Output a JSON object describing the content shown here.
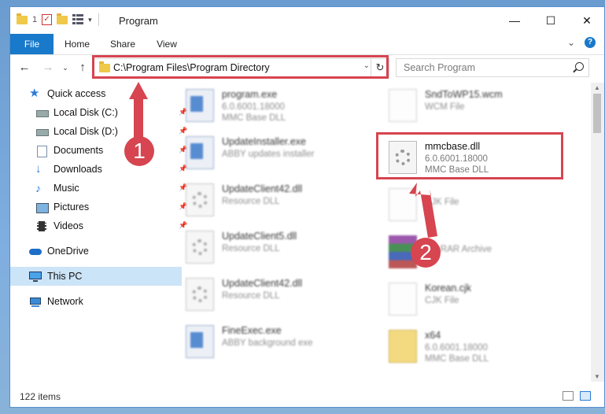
{
  "window": {
    "title": "Program"
  },
  "qat": {
    "number": "1"
  },
  "ribbon": {
    "tabs": [
      "File",
      "Home",
      "Share",
      "View"
    ]
  },
  "address": {
    "path": "C:\\Program Files\\Program Directory"
  },
  "search": {
    "placeholder": "Search Program"
  },
  "sidebar": {
    "items": [
      {
        "label": "Quick access",
        "icon": "star-icon"
      },
      {
        "label": "Local Disk (C:)",
        "icon": "drive-icon",
        "pinned": true
      },
      {
        "label": "Local Disk (D:)",
        "icon": "drive-icon",
        "pinned": true
      },
      {
        "label": "Documents",
        "icon": "documents-icon",
        "pinned": true
      },
      {
        "label": "Downloads",
        "icon": "downloads-icon",
        "pinned": true
      },
      {
        "label": "Music",
        "icon": "music-icon",
        "pinned": true
      },
      {
        "label": "Pictures",
        "icon": "pictures-icon",
        "pinned": true
      },
      {
        "label": "Videos",
        "icon": "videos-icon",
        "pinned": true
      },
      {
        "label": "OneDrive",
        "icon": "cloud-icon"
      },
      {
        "label": "This PC",
        "icon": "computer-icon",
        "selected": true
      },
      {
        "label": "Network",
        "icon": "network-icon"
      }
    ]
  },
  "files": [
    {
      "name": "program.exe",
      "line1": "6.0.6001.18000",
      "line2": "MMC Base DLL",
      "icon": "exe-setup-icon"
    },
    {
      "name": "SndToWP15.wcm",
      "line1": "WCM File",
      "line2": "",
      "icon": "document-icon"
    },
    {
      "name": "UpdateInstaller.exe",
      "line1": "ABBY updates installer",
      "line2": "",
      "icon": "exe-icon"
    },
    {
      "name": "mmcbase.dll",
      "line1": "6.0.6001.18000",
      "line2": "MMC Base DLL",
      "icon": "dll-icon"
    },
    {
      "name": "UpdateClient42.dll",
      "line1": "Resource DLL",
      "line2": "",
      "icon": "dll-icon"
    },
    {
      "name": "",
      "line1": "CJK File",
      "line2": "",
      "icon": "document-icon"
    },
    {
      "name": "UpdateClient5.dll",
      "line1": "Resource DLL",
      "line2": "",
      "icon": "dll-icon"
    },
    {
      "name": "",
      "line1": "WinRAR Archive",
      "line2": "",
      "icon": "archive-icon"
    },
    {
      "name": "UpdateClient42.dll",
      "line1": "Resource DLL",
      "line2": "",
      "icon": "dll-icon"
    },
    {
      "name": "Korean.cjk",
      "line1": "CJK File",
      "line2": "",
      "icon": "document-icon"
    },
    {
      "name": "FineExec.exe",
      "line1": "ABBY background exe",
      "line2": "",
      "icon": "exe-icon"
    },
    {
      "name": "x64",
      "line1": "6.0.6001.18000",
      "line2": "MMC Base DLL",
      "icon": "zip-folder-icon"
    }
  ],
  "status": {
    "item_count": "122 items"
  },
  "annotations": {
    "step1": "1",
    "step2": "2",
    "color": "#d64550"
  }
}
